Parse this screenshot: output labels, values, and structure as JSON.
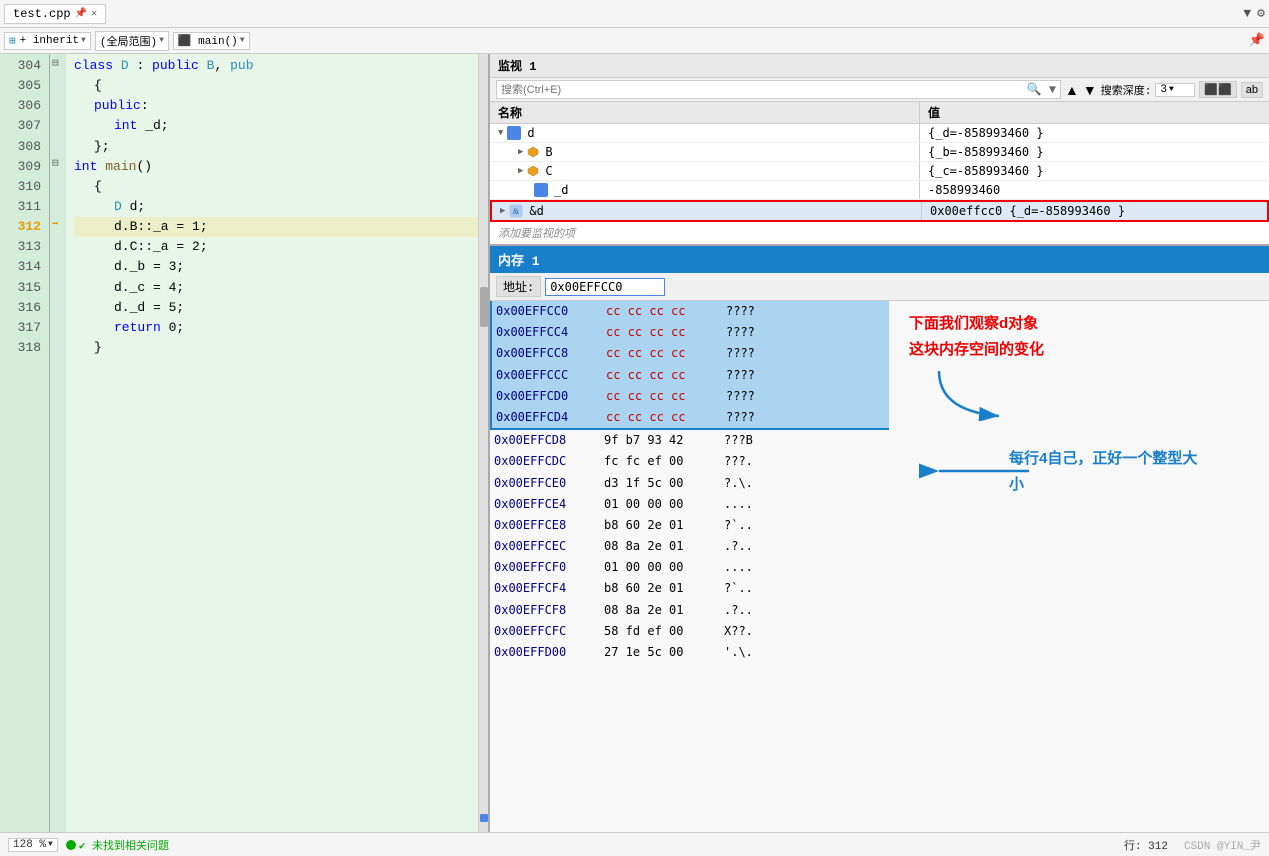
{
  "editor": {
    "filename": "test.cpp",
    "tab_label": "test.cpp",
    "toolbar": {
      "inherit_label": "+ inherit",
      "scope_label": "(全局范围)",
      "func_label": "⬛ main()"
    },
    "lines": [
      {
        "num": "304",
        "content": "class D : public B, pub",
        "indent": 0,
        "has_collapse": true,
        "type": "class"
      },
      {
        "num": "305",
        "content": "{",
        "indent": 1,
        "type": "normal"
      },
      {
        "num": "306",
        "content": "public:",
        "indent": 1,
        "type": "keyword"
      },
      {
        "num": "307",
        "content": "int _d;",
        "indent": 2,
        "type": "normal"
      },
      {
        "num": "308",
        "content": "};",
        "indent": 1,
        "type": "normal"
      },
      {
        "num": "309",
        "content": "int main()",
        "indent": 0,
        "has_collapse": true,
        "type": "func"
      },
      {
        "num": "310",
        "content": "{",
        "indent": 1,
        "type": "normal"
      },
      {
        "num": "311",
        "content": "D d;",
        "indent": 2,
        "type": "normal"
      },
      {
        "num": "312",
        "content": "d.B::_a = 1;",
        "indent": 2,
        "type": "current"
      },
      {
        "num": "313",
        "content": "d.C::_a = 2;",
        "indent": 2,
        "type": "normal"
      },
      {
        "num": "314",
        "content": "d._b = 3;",
        "indent": 2,
        "type": "normal"
      },
      {
        "num": "315",
        "content": "d._c = 4;",
        "indent": 2,
        "type": "normal"
      },
      {
        "num": "316",
        "content": "d._d = 5;",
        "indent": 2,
        "type": "normal"
      },
      {
        "num": "317",
        "content": "return 0;",
        "indent": 2,
        "type": "normal"
      },
      {
        "num": "318",
        "content": "}",
        "indent": 1,
        "type": "normal"
      }
    ]
  },
  "watch": {
    "panel_title": "监视 1",
    "search_placeholder": "搜索(Ctrl+E)",
    "depth_label": "搜索深度:",
    "depth_value": "3",
    "col_name": "名称",
    "col_value": "值",
    "rows": [
      {
        "id": "d",
        "name": "d",
        "indent": 0,
        "expanded": true,
        "has_expand": true,
        "icon": "cube",
        "value": "{_d=-858993460 }"
      },
      {
        "id": "B",
        "name": "B",
        "indent": 1,
        "expanded": false,
        "has_expand": true,
        "icon": "cube-small",
        "value": "{_b=-858993460 }"
      },
      {
        "id": "C",
        "name": "C",
        "indent": 1,
        "expanded": false,
        "has_expand": true,
        "icon": "cube-small",
        "value": "{_c=-858993460 }"
      },
      {
        "id": "_d",
        "name": "_d",
        "indent": 1,
        "expanded": false,
        "has_expand": false,
        "icon": "cube-small",
        "value": "-858993460"
      },
      {
        "id": "&d",
        "name": "&d",
        "indent": 0,
        "expanded": false,
        "has_expand": true,
        "icon": "ref",
        "value": "0x00effcc0 {_d=-858993460 }",
        "highlighted": true
      }
    ],
    "add_hint": "添加要监视的项"
  },
  "memory": {
    "panel_title": "内存 1",
    "address_label": "地址:",
    "address_value": "0x00EFFCC0",
    "rows": [
      {
        "addr": "0x00EFFCC0",
        "bytes": "cc cc cc cc",
        "ascii": "????",
        "highlighted": true
      },
      {
        "addr": "0x00EFFCC4",
        "bytes": "cc cc cc cc",
        "ascii": "????",
        "highlighted": true
      },
      {
        "addr": "0x00EFFCC8",
        "bytes": "cc cc cc cc",
        "ascii": "????",
        "highlighted": true
      },
      {
        "addr": "0x00EFFCCC",
        "bytes": "cc cc cc cc",
        "ascii": "????",
        "highlighted": true
      },
      {
        "addr": "0x00EFFCD0",
        "bytes": "cc cc cc cc",
        "ascii": "????",
        "highlighted": true
      },
      {
        "addr": "0x00EFFCD4",
        "bytes": "cc cc cc cc",
        "ascii": "????",
        "highlighted": true
      },
      {
        "addr": "0x00EFFCD8",
        "bytes": "9f b7 93 42",
        "ascii": "???B",
        "highlighted": false
      },
      {
        "addr": "0x00EFFCDC",
        "bytes": "fc fc ef 00",
        "ascii": "???.",
        "highlighted": false
      },
      {
        "addr": "0x00EFFCE0",
        "bytes": "d3 1f 5c 00",
        "ascii": "?.\\.",
        "highlighted": false
      },
      {
        "addr": "0x00EFFCE4",
        "bytes": "01 00 00 00",
        "ascii": "....",
        "highlighted": false
      },
      {
        "addr": "0x00EFFCE8",
        "bytes": "b8 60 2e 01",
        "ascii": "?`..",
        "highlighted": false
      },
      {
        "addr": "0x00EFFCEC",
        "bytes": "08 8a 2e 01",
        "ascii": ".?.. ",
        "highlighted": false
      },
      {
        "addr": "0x00EFFCF0",
        "bytes": "01 00 00 00",
        "ascii": "....",
        "highlighted": false
      },
      {
        "addr": "0x00EFFCF4",
        "bytes": "b8 60 2e 01",
        "ascii": "?`..",
        "highlighted": false
      },
      {
        "addr": "0x00EFFCF8",
        "bytes": "08 8a 2e 01",
        "ascii": ".?.. ",
        "highlighted": false
      },
      {
        "addr": "0x00EFFCFC",
        "bytes": "58 fd ef 00",
        "ascii": "X??.",
        "highlighted": false
      },
      {
        "addr": "0x00EFFD00",
        "bytes": "27 1e 5c 00",
        "ascii": "'.\\.",
        "highlighted": false
      }
    ],
    "annotation1": "下面我们观察d对象\n这块内存空间的变化",
    "annotation2": "每行4自己，正好一个整型大\n小"
  },
  "bottom_bar": {
    "zoom": "128 %",
    "status": "✔ 未找到相关问题",
    "line_info": "行: 312",
    "watermark": "CSDN @YIN_尹"
  }
}
